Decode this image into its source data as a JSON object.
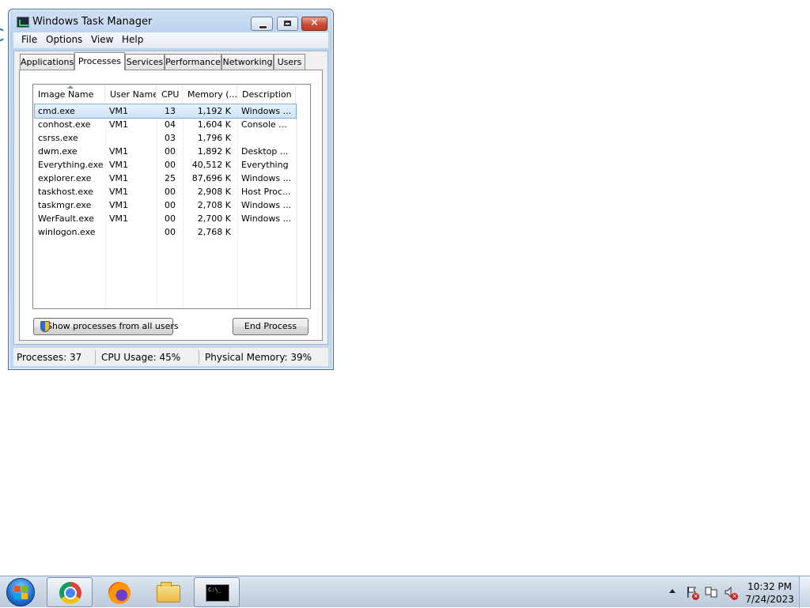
{
  "window": {
    "title": "Windows Task Manager",
    "close_glyph": "✕"
  },
  "menu": [
    "File",
    "Options",
    "View",
    "Help"
  ],
  "tabs": [
    "Applications",
    "Processes",
    "Services",
    "Performance",
    "Networking",
    "Users"
  ],
  "active_tab": "Processes",
  "process_list": {
    "columns": [
      "Image Name",
      "User Name",
      "CPU",
      "Memory (...",
      "Description"
    ],
    "sort_column": "Image Name",
    "rows": [
      {
        "name": "cmd.exe",
        "user": "VM1",
        "cpu": "13",
        "memory": "1,192 K",
        "description": "Windows ...",
        "selected": true
      },
      {
        "name": "conhost.exe",
        "user": "VM1",
        "cpu": "04",
        "memory": "1,604 K",
        "description": "Console ..."
      },
      {
        "name": "csrss.exe",
        "user": "",
        "cpu": "03",
        "memory": "1,796 K",
        "description": ""
      },
      {
        "name": "dwm.exe",
        "user": "VM1",
        "cpu": "00",
        "memory": "1,892 K",
        "description": "Desktop ..."
      },
      {
        "name": "Everything.exe",
        "user": "VM1",
        "cpu": "00",
        "memory": "40,512 K",
        "description": "Everything"
      },
      {
        "name": "explorer.exe",
        "user": "VM1",
        "cpu": "25",
        "memory": "87,696 K",
        "description": "Windows ..."
      },
      {
        "name": "taskhost.exe",
        "user": "VM1",
        "cpu": "00",
        "memory": "2,908 K",
        "description": "Host Proc..."
      },
      {
        "name": "taskmgr.exe",
        "user": "VM1",
        "cpu": "00",
        "memory": "2,708 K",
        "description": "Windows ..."
      },
      {
        "name": "WerFault.exe",
        "user": "VM1",
        "cpu": "00",
        "memory": "2,700 K",
        "description": "Windows ..."
      },
      {
        "name": "winlogon.exe",
        "user": "",
        "cpu": "00",
        "memory": "2,768 K",
        "description": ""
      }
    ]
  },
  "buttons": {
    "show_all": "Show processes from all users",
    "end_process": "End Process"
  },
  "status": {
    "processes": "Processes: 37",
    "cpu": "CPU Usage: 45%",
    "memory": "Physical Memory: 39%"
  },
  "taskbar": {
    "items": [
      "chrome-icon",
      "firefox-icon",
      "file-explorer-icon",
      "command-prompt-icon"
    ],
    "cmd_glyph": "C:\\_",
    "tray_icons": [
      "show-hidden-icons-chevron",
      "action-center-icon",
      "network-icon",
      "volume-muted-icon"
    ],
    "tray_x_glyph": "×",
    "time": "10:32 PM",
    "date": "7/24/2023"
  },
  "colors": {
    "selection": "#cde3fb",
    "title_gradient_top": "#cfe0f3",
    "close_button": "#cc4b32"
  }
}
